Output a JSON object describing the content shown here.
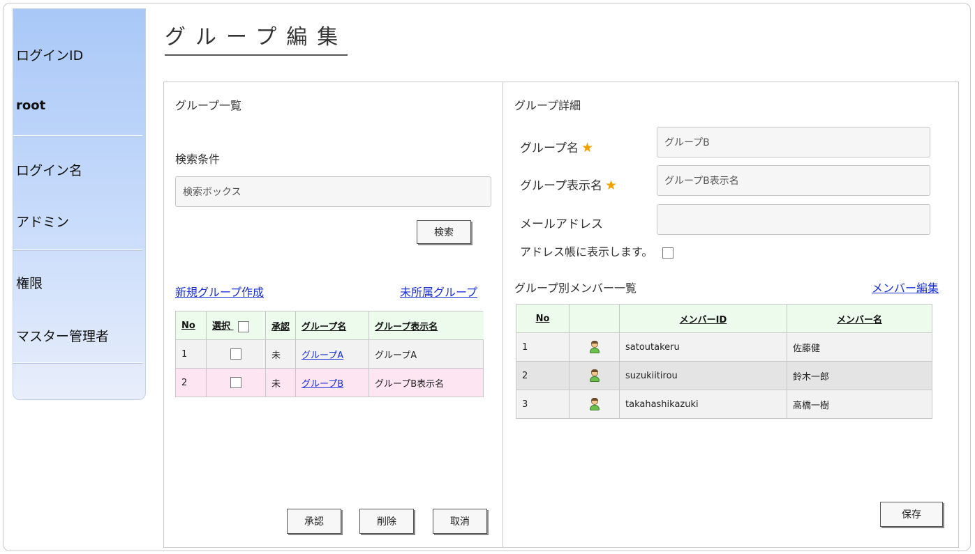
{
  "page": {
    "title": "グループ編集"
  },
  "sidebar": {
    "login_id_label": "ログインID",
    "login_id_value": "root",
    "login_name_label": "ログイン名",
    "login_name_value": "アドミン",
    "role_label": "権限",
    "role_value": "マスター管理者"
  },
  "left_panel": {
    "heading": "グループ一覧",
    "search_label": "検索条件",
    "search_placeholder": "検索ボックス",
    "search_button": "検索",
    "new_group_link": "新規グループ作成",
    "unassigned_link": "未所属グループ",
    "table": {
      "headers": [
        "No",
        "選択",
        "承認",
        "グループ名",
        "グループ表示名"
      ],
      "rows": [
        {
          "no": "1",
          "approved": "未",
          "name": "グループA",
          "display": "グループA"
        },
        {
          "no": "2",
          "approved": "未",
          "name": "グループB",
          "display": "グループB表示名"
        }
      ]
    },
    "approve_button": "承認",
    "delete_button": "削除",
    "cancel_button": "取消"
  },
  "right_panel": {
    "heading": "グループ詳細",
    "group_name_label": "グループ名",
    "group_name_value": "グループB",
    "display_name_label": "グループ表示名",
    "display_name_value": "グループB表示名",
    "email_label": "メールアドレス",
    "email_value": "",
    "address_book_label": "アドレス帳に表示します。",
    "member_list_label": "グループ別メンバー一覧",
    "member_edit_link": "メンバー編集",
    "table": {
      "headers": [
        "No",
        "",
        "メンバーID",
        "メンバー名"
      ],
      "rows": [
        {
          "no": "1",
          "id": "satoutakeru",
          "name": "佐藤健"
        },
        {
          "no": "2",
          "id": "suzukiitirou",
          "name": "鈴木一郎"
        },
        {
          "no": "3",
          "id": "takahashikazuki",
          "name": "高橋一樹"
        }
      ]
    },
    "save_button": "保存"
  },
  "colors": {
    "accent_link": "#1a2fd6",
    "star": "#f0a000",
    "header_bg": "#ecfbec",
    "selected_row": "#fde6f1"
  },
  "icons": {
    "required": "star-icon",
    "member": "user-avatar-icon"
  }
}
